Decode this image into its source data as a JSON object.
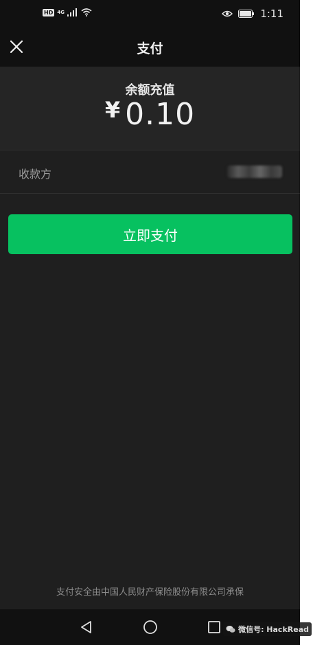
{
  "status_bar": {
    "hd_badge": "HD",
    "network": "4G",
    "time": "1:11"
  },
  "nav": {
    "title": "支付"
  },
  "amount_section": {
    "label": "余额充值",
    "currency": "¥",
    "value": "0.10"
  },
  "payee": {
    "label": "收款方"
  },
  "actions": {
    "pay_label": "立即支付"
  },
  "footer": {
    "note": "支付安全由中国人民财产保险股份有限公司承保"
  },
  "watermark": {
    "text": "微信号: HackRead"
  },
  "colors": {
    "primary": "#07c160",
    "background": "#1f1f1f",
    "surface": "#252525",
    "bar": "#111111"
  }
}
